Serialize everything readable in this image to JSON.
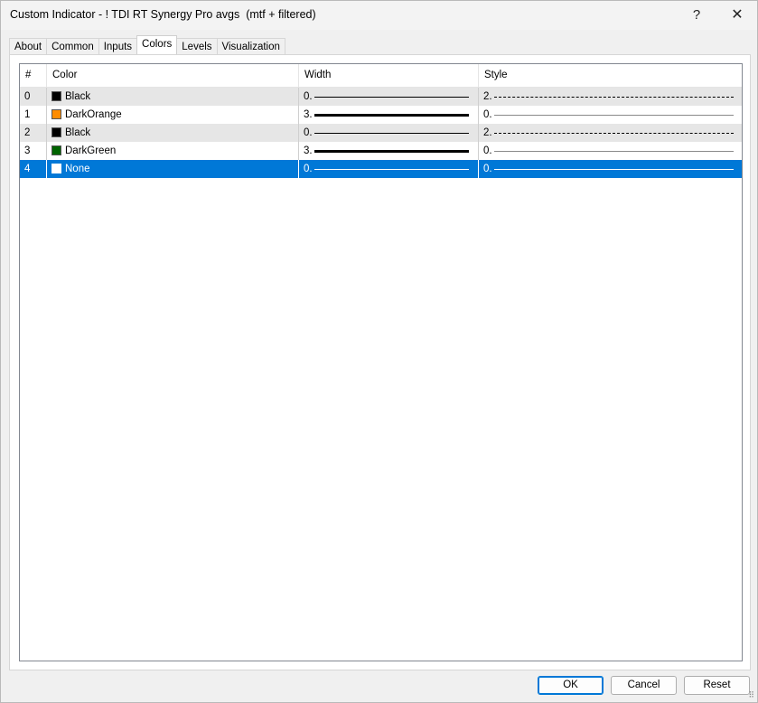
{
  "window": {
    "title": "Custom Indicator - ! TDI RT Synergy Pro avgs  (mtf + filtered)",
    "help_glyph": "?",
    "close_glyph": "✕"
  },
  "tabs": [
    {
      "label": "About",
      "active": false
    },
    {
      "label": "Common",
      "active": false
    },
    {
      "label": "Inputs",
      "active": false
    },
    {
      "label": "Colors",
      "active": true
    },
    {
      "label": "Levels",
      "active": false
    },
    {
      "label": "Visualization",
      "active": false
    }
  ],
  "table": {
    "columns": [
      "#",
      "Color",
      "Width",
      "Style"
    ],
    "rows": [
      {
        "index": "0",
        "color_name": "Black",
        "color_hex": "#000000",
        "width_label": "0.",
        "width_value": 0,
        "style_label": "2.",
        "style_kind": "dashed",
        "selected": false
      },
      {
        "index": "1",
        "color_name": "DarkOrange",
        "color_hex": "#ff8c00",
        "width_label": "3.",
        "width_value": 3,
        "style_label": "0.",
        "style_kind": "solid",
        "selected": false
      },
      {
        "index": "2",
        "color_name": "Black",
        "color_hex": "#000000",
        "width_label": "0.",
        "width_value": 0,
        "style_label": "2.",
        "style_kind": "dashed",
        "selected": false
      },
      {
        "index": "3",
        "color_name": "DarkGreen",
        "color_hex": "#006400",
        "width_label": "3.",
        "width_value": 3,
        "style_label": "0.",
        "style_kind": "solid",
        "selected": false
      },
      {
        "index": "4",
        "color_name": "None",
        "color_hex": "#ffffff",
        "width_label": "0.",
        "width_value": 0,
        "style_label": "0.",
        "style_kind": "solid",
        "selected": true
      }
    ]
  },
  "buttons": {
    "ok": "OK",
    "cancel": "Cancel",
    "reset": "Reset"
  },
  "colors": {
    "selection": "#0078d7",
    "alt_row": "#e6e6e6"
  }
}
